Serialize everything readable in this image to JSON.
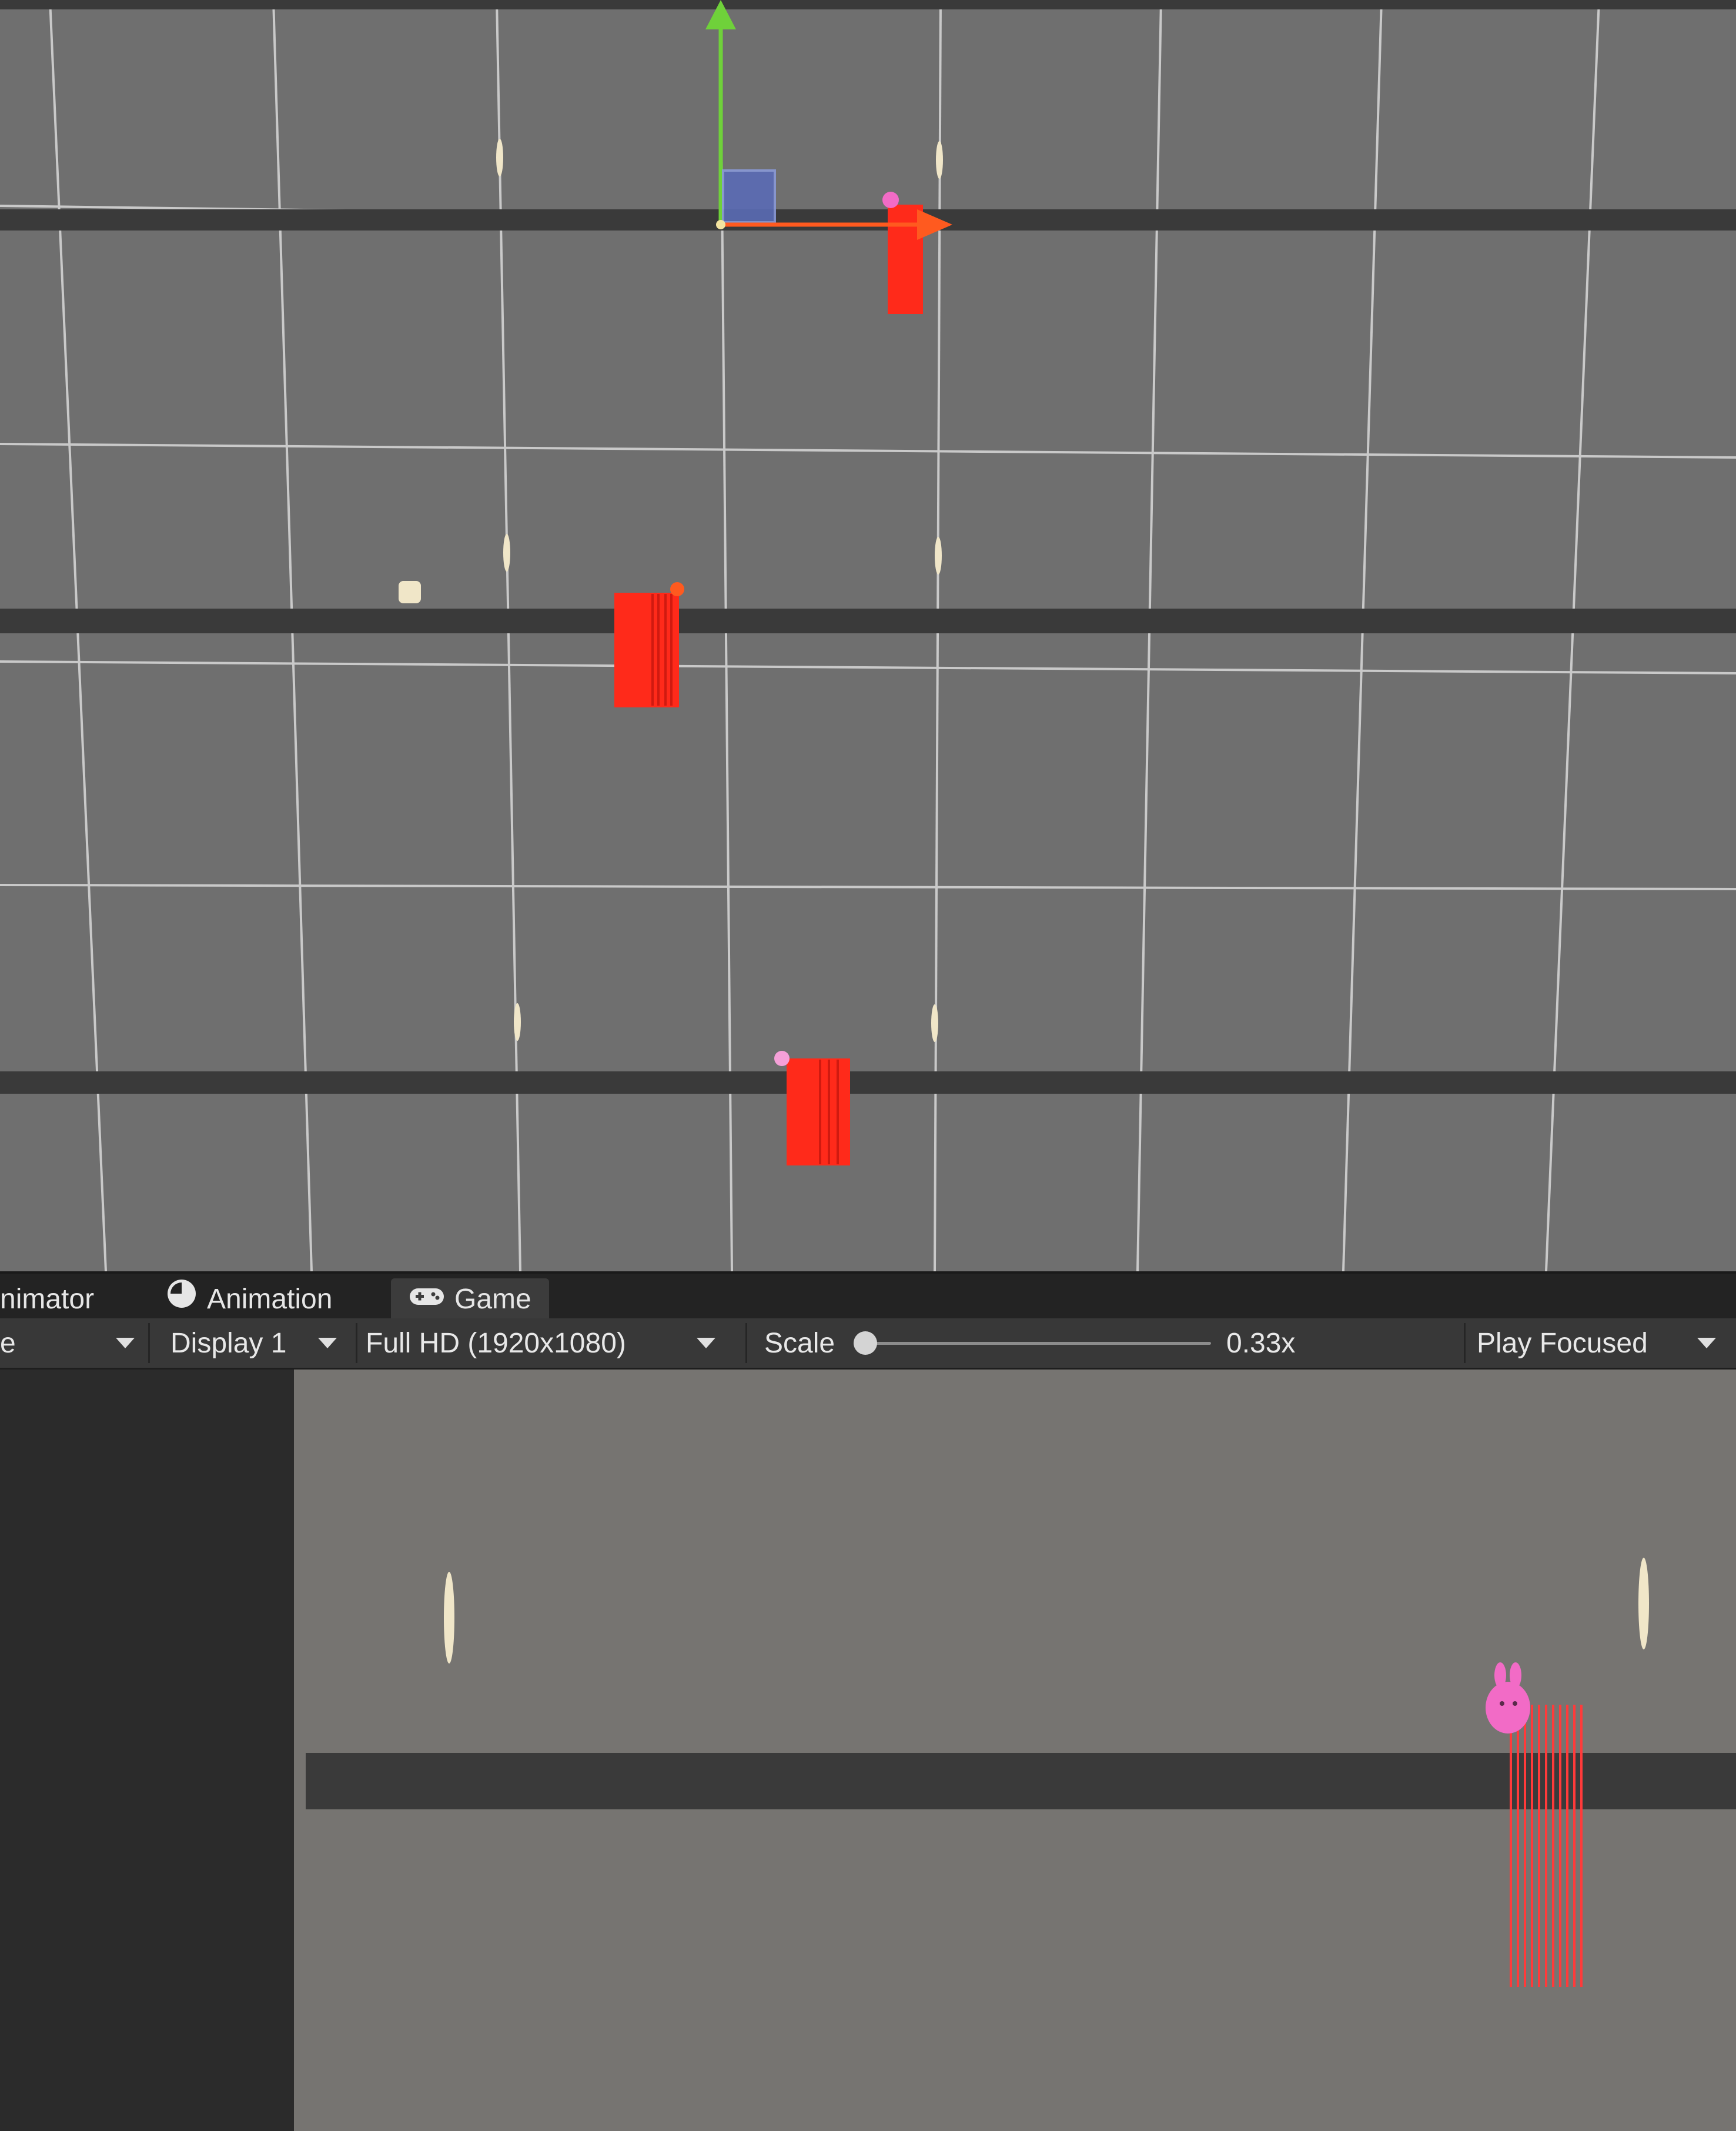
{
  "tabs": [
    {
      "label": "nimator",
      "icon": "animator-icon",
      "active": false
    },
    {
      "label": "Animation",
      "icon": "clock-icon",
      "active": false
    },
    {
      "label": "Game",
      "icon": "gamepad-icon",
      "active": true
    }
  ],
  "toolbar": {
    "left_dropdown_label": "e",
    "display": "Display 1",
    "resolution": "Full HD (1920x1080)",
    "scale_label": "Scale",
    "scale_value": "0.33x",
    "play_mode": "Play Focused"
  },
  "colors": {
    "scene_background": "#6f6f6f",
    "grid_line": "#d8d8d8",
    "platform": "#3a3a3a",
    "obstacle": "#ff2a1a",
    "gizmo_x": "#ff5a1f",
    "gizmo_y": "#6fd13a",
    "gizmo_plane": "#5a6bb5",
    "player_pink": "#f26bc6",
    "coin": "#f0e6c8",
    "game_background": "#767471"
  }
}
